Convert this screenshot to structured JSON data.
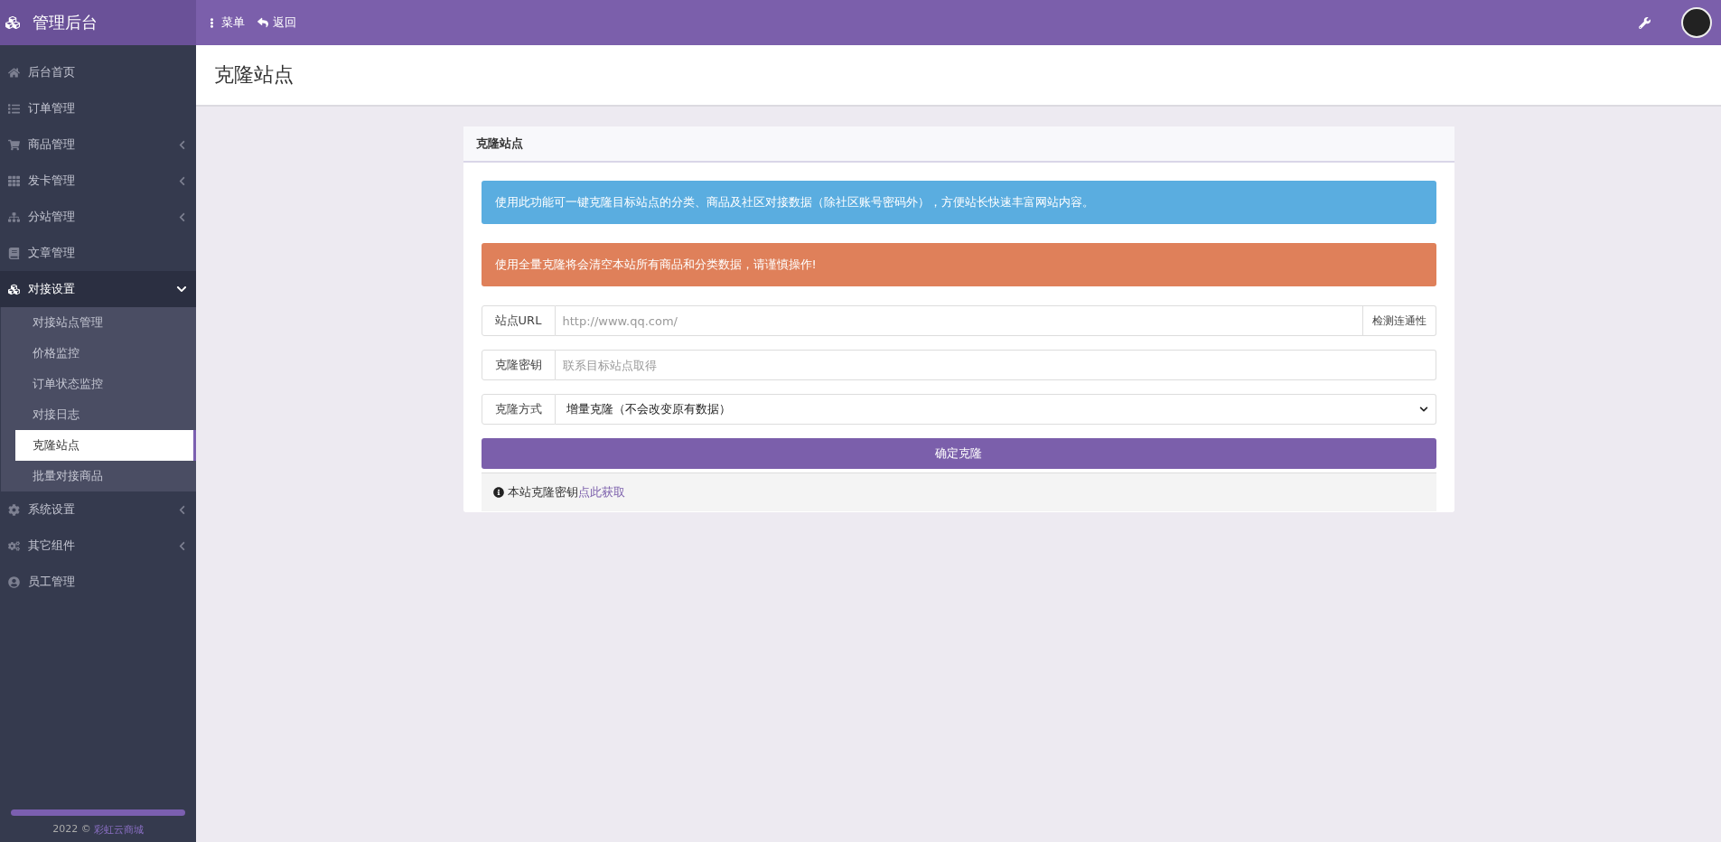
{
  "brand": {
    "title": "管理后台"
  },
  "topbar": {
    "menu": "菜单",
    "back": "返回"
  },
  "sidebar": {
    "items": [
      {
        "label": "后台首页",
        "caret": false,
        "expanded": false
      },
      {
        "label": "订单管理",
        "caret": false,
        "expanded": false
      },
      {
        "label": "商品管理",
        "caret": true,
        "expanded": false
      },
      {
        "label": "发卡管理",
        "caret": true,
        "expanded": false
      },
      {
        "label": "分站管理",
        "caret": true,
        "expanded": false
      },
      {
        "label": "文章管理",
        "caret": false,
        "expanded": false
      },
      {
        "label": "对接设置",
        "caret": true,
        "expanded": true,
        "children": [
          {
            "label": "对接站点管理",
            "selected": false
          },
          {
            "label": "价格监控",
            "selected": false
          },
          {
            "label": "订单状态监控",
            "selected": false
          },
          {
            "label": "对接日志",
            "selected": false
          },
          {
            "label": "克隆站点",
            "selected": true
          },
          {
            "label": "批量对接商品",
            "selected": false
          }
        ]
      },
      {
        "label": "系统设置",
        "caret": true,
        "expanded": false
      },
      {
        "label": "其它组件",
        "caret": true,
        "expanded": false
      },
      {
        "label": "员工管理",
        "caret": false,
        "expanded": false
      }
    ],
    "footer": {
      "year": "2022 ©",
      "link": "彩虹云商城"
    }
  },
  "page": {
    "title": "克隆站点"
  },
  "card": {
    "title": "克隆站点",
    "alerts": [
      {
        "kind": "info",
        "text": "使用此功能可一键克隆目标站点的分类、商品及社区对接数据（除社区账号密码外），方便站长快速丰富网站内容。"
      },
      {
        "kind": "warning",
        "text": "使用全量克隆将会清空本站所有商品和分类数据，请谨慎操作!"
      }
    ],
    "fields": [
      {
        "kind": "input",
        "label": "站点URL",
        "placeholder": "http://www.qq.com/",
        "button": "检测连通性"
      },
      {
        "kind": "input",
        "label": "克隆密钥",
        "placeholder": "联系目标站点取得"
      },
      {
        "kind": "select",
        "label": "克隆方式",
        "value": "增量克隆（不会改变原有数据）"
      }
    ],
    "submit": "确定克隆",
    "footer": {
      "text": "本站克隆密钥",
      "link": "点此获取"
    }
  }
}
